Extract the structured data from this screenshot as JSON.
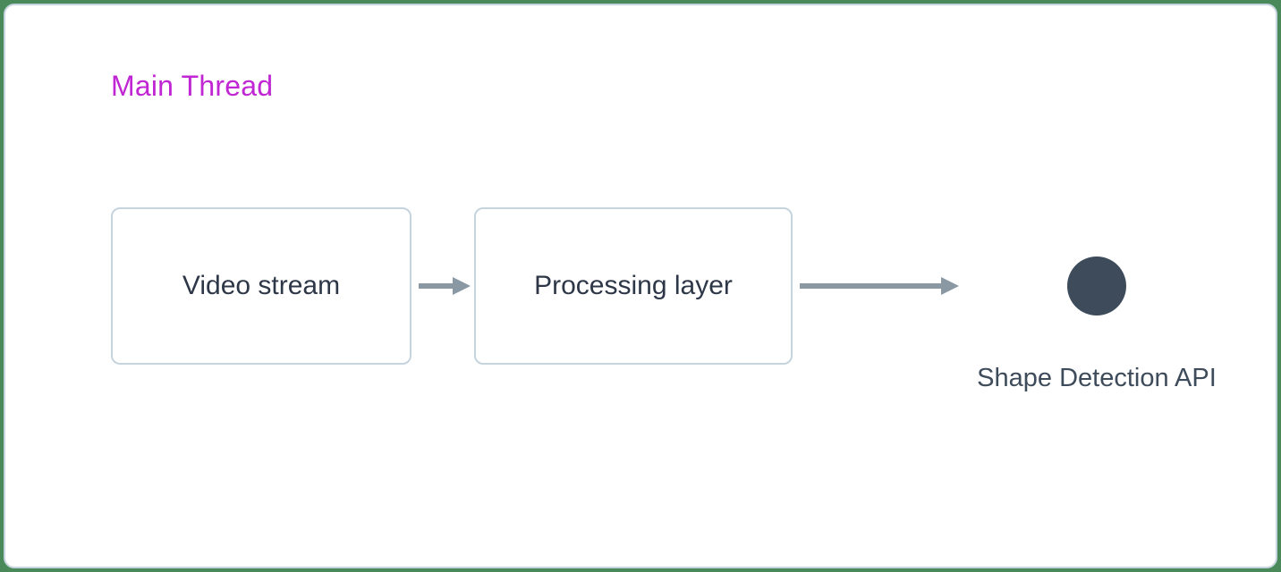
{
  "diagram": {
    "title": "Main Thread",
    "nodes": {
      "video_stream": "Video stream",
      "processing_layer": "Processing layer",
      "shape_detection_api": "Shape Detection API"
    },
    "colors": {
      "title": "#c026d3",
      "border": "#c5d4dd",
      "text": "#2d3748",
      "arrow": "#8a98a3",
      "dot": "#3e4b5b"
    }
  }
}
